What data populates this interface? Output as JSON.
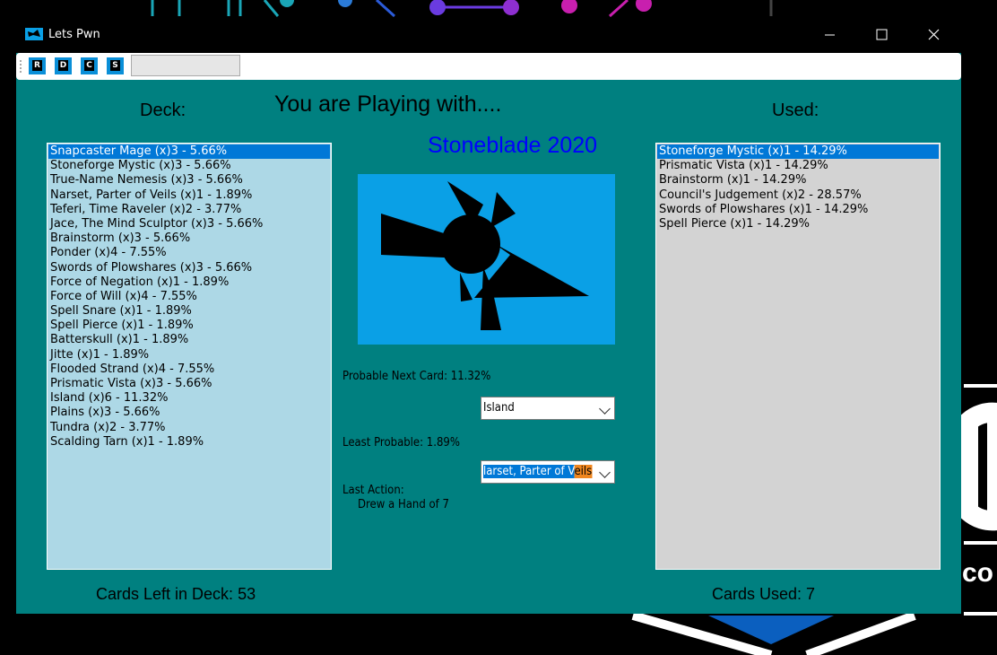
{
  "window": {
    "title": "Lets Pwn"
  },
  "title_controls": {
    "minimize_icon": "minimize-icon",
    "maximize_icon": "maximize-icon",
    "close_icon": "close-icon"
  },
  "toolbar": {
    "buttons": [
      {
        "label": "R"
      },
      {
        "label": "D"
      },
      {
        "label": "C"
      },
      {
        "label": "S"
      }
    ],
    "input_value": ""
  },
  "headings": {
    "deck": "Deck:",
    "playing": "You are Playing with....",
    "used": "Used:",
    "deck_name": "Stoneblade 2020"
  },
  "deck": {
    "items": [
      "Snapcaster Mage (x)3 - 5.66%",
      "Stoneforge Mystic (x)3 - 5.66%",
      "True-Name Nemesis (x)3 - 5.66%",
      "Narset, Parter of Veils (x)1 - 1.89%",
      "Teferi, Time Raveler (x)2 - 3.77%",
      "Jace, The Mind Sculptor (x)3 - 5.66%",
      "Brainstorm (x)3 - 5.66%",
      "Ponder (x)4 - 7.55%",
      "Swords of Plowshares (x)3 - 5.66%",
      "Force of Negation (x)1 - 1.89%",
      "Force of Will (x)4 - 7.55%",
      "Spell Snare (x)1 - 1.89%",
      "Spell Pierce (x)1 - 1.89%",
      "Batterskull (x)1 - 1.89%",
      "Jitte (x)1 - 1.89%",
      "Flooded Strand (x)4 - 7.55%",
      "Prismatic Vista (x)3 - 5.66%",
      "Island (x)6 - 11.32%",
      "Plains (x)3 - 5.66%",
      "Tundra (x)2 - 3.77%",
      "Scalding Tarn (x)1 - 1.89%"
    ],
    "selected_index": 0
  },
  "used": {
    "items": [
      "Stoneforge Mystic (x)1 - 14.29%",
      "Prismatic Vista (x)1 - 14.29%",
      "Brainstorm (x)1 - 14.29%",
      "Council's Judgement (x)2 - 28.57%",
      "Swords of Plowshares (x)1 - 14.29%",
      "Spell Pierce (x)1 - 14.29%"
    ],
    "selected_index": 0
  },
  "center": {
    "probable_label": "Probable Next Card: 11.32%",
    "probable_value": "Island",
    "least_label": "Least Probable: 1.89%",
    "least_value_selected": "larset, Parter of V",
    "least_value_highlight": "eils",
    "last_action_label": "Last Action:",
    "last_action_value": "Drew a Hand of 7"
  },
  "footer": {
    "cards_left": "Cards Left in Deck: 53",
    "cards_used": "Cards Used: 7"
  },
  "colors": {
    "window_bg": "#008080",
    "deck_list_bg": "#add8e6",
    "used_list_bg": "#d3d3d3",
    "selection": "#0078d7",
    "deck_name": "#0000ff",
    "art_bg": "#0aa0e6"
  }
}
